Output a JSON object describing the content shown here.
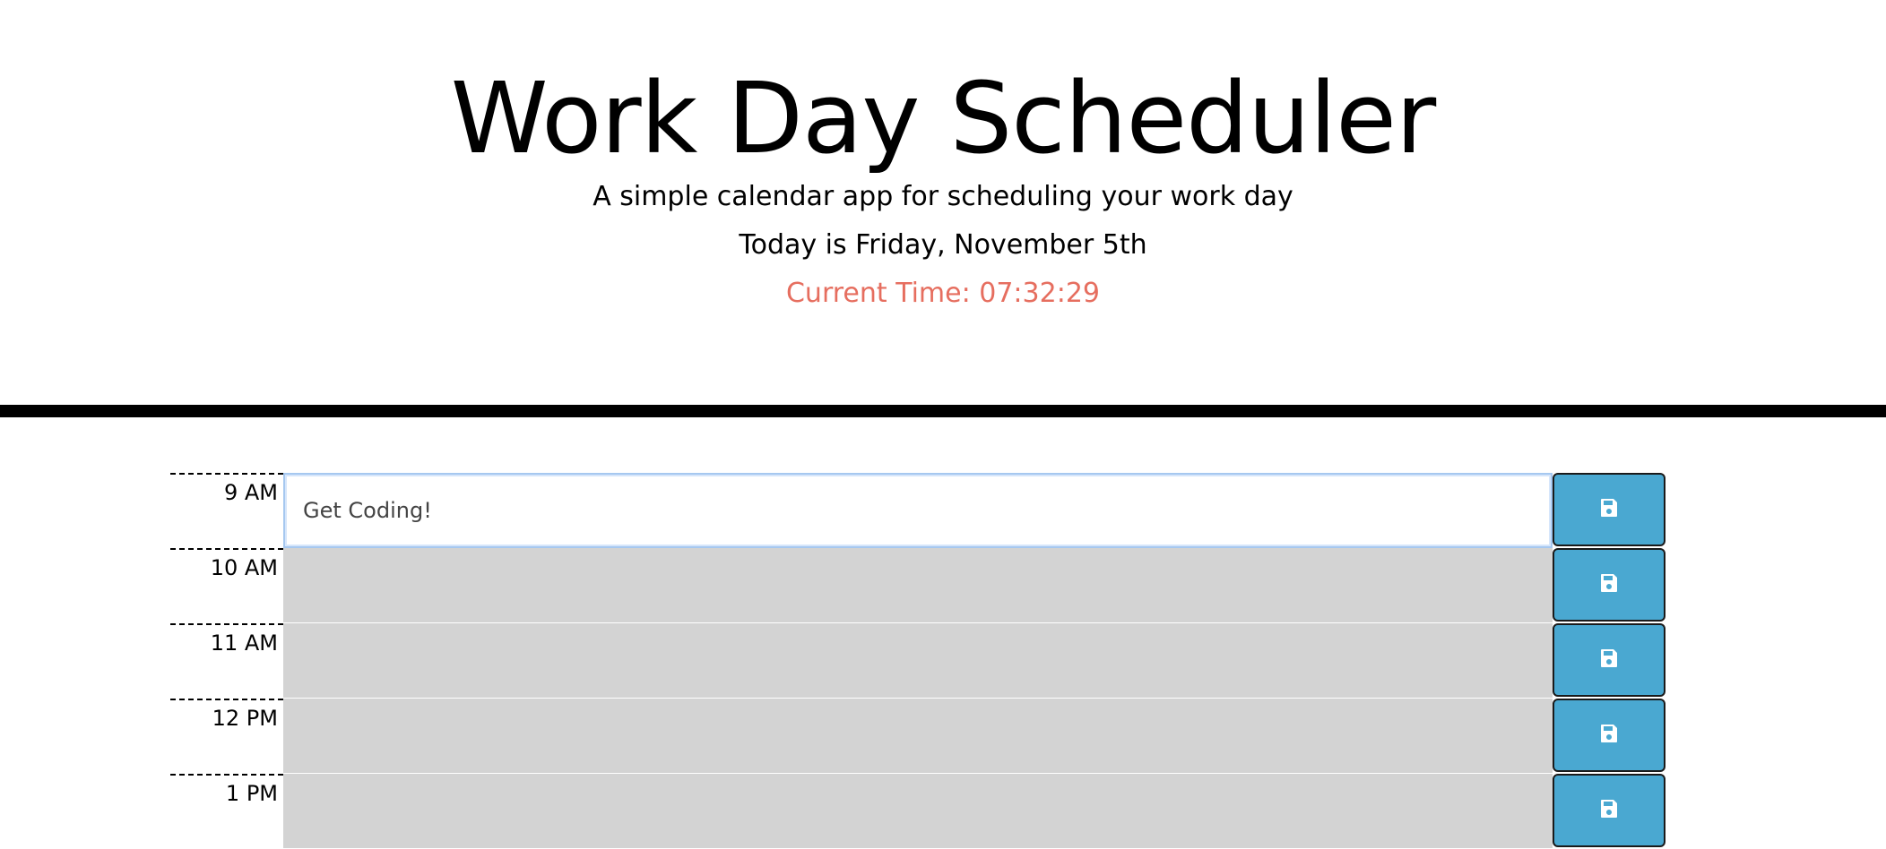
{
  "header": {
    "title": "Work Day Scheduler",
    "subtitle": "A simple calendar app for scheduling your work day",
    "today": "Today is Friday, November 5th",
    "current_time": "Current Time: 07:32:29"
  },
  "colors": {
    "time_text": "#e66e5f",
    "past_block": "#d3d3d3",
    "save_button": "#4aa8d1",
    "divider": "#000000"
  },
  "schedule": {
    "rows": [
      {
        "hour": "9 AM",
        "text": "Get Coding!",
        "active": true
      },
      {
        "hour": "10 AM",
        "text": ""
      },
      {
        "hour": "11 AM",
        "text": ""
      },
      {
        "hour": "12 PM",
        "text": ""
      },
      {
        "hour": "1 PM",
        "text": ""
      }
    ],
    "save_icon": "floppy-disk-icon"
  }
}
